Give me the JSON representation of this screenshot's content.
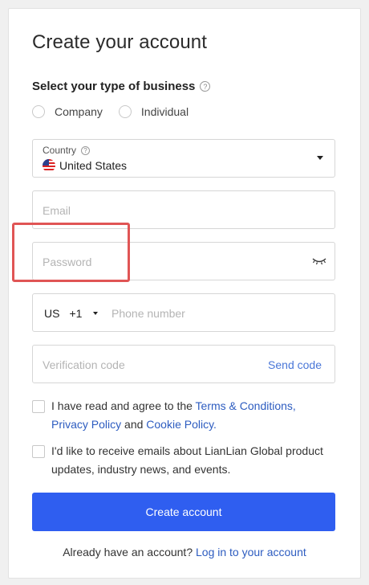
{
  "title": "Create your account",
  "business_type": {
    "label": "Select your type of business",
    "help_glyph": "?",
    "options": [
      "Company",
      "Individual"
    ]
  },
  "country": {
    "caption": "Country",
    "help_glyph": "?",
    "value": "United States"
  },
  "email": {
    "placeholder": "Email"
  },
  "password": {
    "placeholder": "Password"
  },
  "phone": {
    "country_code": "US",
    "dial_code": "+1",
    "placeholder": "Phone number"
  },
  "verification": {
    "placeholder": "Verification code",
    "send_label": "Send code"
  },
  "agreement": {
    "prefix": "I have read and agree to the ",
    "terms": "Terms & Conditions,",
    "privacy": "Privacy Policy",
    "and": " and ",
    "cookie": "Cookie Policy."
  },
  "marketing": {
    "text": "I'd like to receive emails about LianLian Global product updates, industry news, and events."
  },
  "create_button": "Create account",
  "footer": {
    "prompt": "Already have an account? ",
    "login_link": "Log in to your account"
  },
  "colors": {
    "primary": "#2f5ef0",
    "link": "#2d5cc0",
    "highlight": "#e05555"
  }
}
